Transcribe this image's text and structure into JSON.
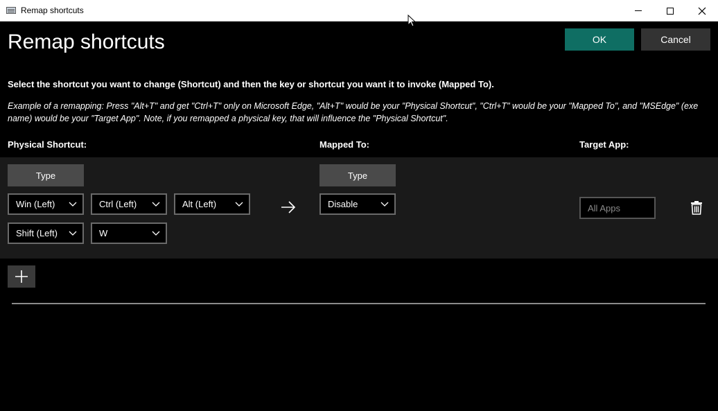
{
  "window": {
    "title": "Remap shortcuts",
    "controls": {
      "minimize": "minimize",
      "maximize": "maximize",
      "close": "close"
    }
  },
  "header": {
    "title": "Remap shortcuts",
    "ok_label": "OK",
    "cancel_label": "Cancel"
  },
  "instructions": {
    "main": "Select the shortcut you want to change (Shortcut) and then the key or shortcut you want it to invoke (Mapped To).",
    "example": "Example of a remapping: Press \"Alt+T\" and get \"Ctrl+T\" only on Microsoft Edge, \"Alt+T\" would be your \"Physical Shortcut\", \"Ctrl+T\" would be your \"Mapped To\", and \"MSEdge\" (exe name) would be your \"Target App\". Note, if you remapped a physical key, that will influence the \"Physical Shortcut\"."
  },
  "columns": {
    "physical": "Physical Shortcut:",
    "mapped": "Mapped To:",
    "target": "Target App:"
  },
  "row": {
    "physical_type_label": "Type",
    "physical_keys": [
      "Win (Left)",
      "Ctrl (Left)",
      "Alt (Left)",
      "Shift (Left)",
      "W"
    ],
    "mapped_type_label": "Type",
    "mapped_key": "Disable",
    "target_placeholder": "All Apps"
  },
  "icons": {
    "arrow": "arrow-right-icon",
    "delete": "trash-icon",
    "add": "plus-icon",
    "chevron": "chevron-down-icon"
  },
  "colors": {
    "accent": "#0f6e63",
    "background": "#000000",
    "row_background": "#1a1a1a"
  }
}
